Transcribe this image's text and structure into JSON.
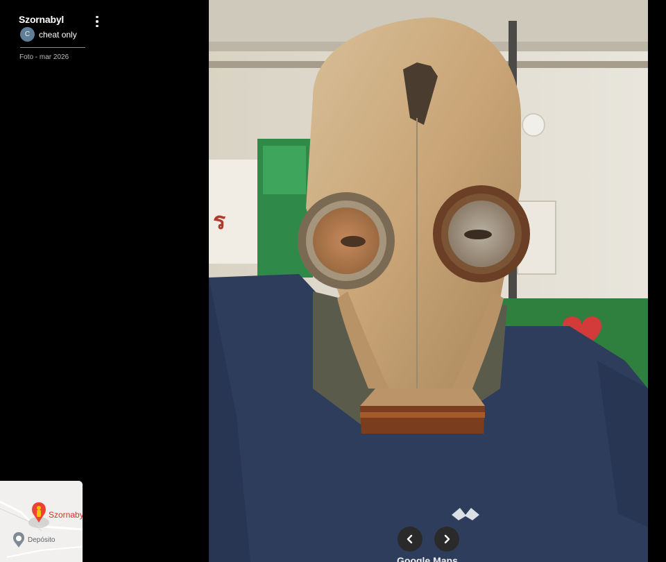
{
  "place": {
    "title": "Szornabyl",
    "author_initial": "C",
    "author_name": "cheat only",
    "photo_date": "Foto - mar 2026"
  },
  "minimap": {
    "main_label": "Szornaby",
    "secondary_label": "Depósito",
    "pin_icon": "person-pin-icon",
    "secondary_icon": "place-pin-icon"
  },
  "photo": {
    "subject": "gas-mask-photo"
  },
  "nav": {
    "prev_icon": "chevron-left-icon",
    "next_icon": "chevron-right-icon"
  },
  "brand": {
    "label": "Google Maps"
  },
  "colors": {
    "background": "#000000",
    "pin_red": "#ea4335",
    "label_red": "#d93025",
    "avatar": "#5f7f98"
  }
}
